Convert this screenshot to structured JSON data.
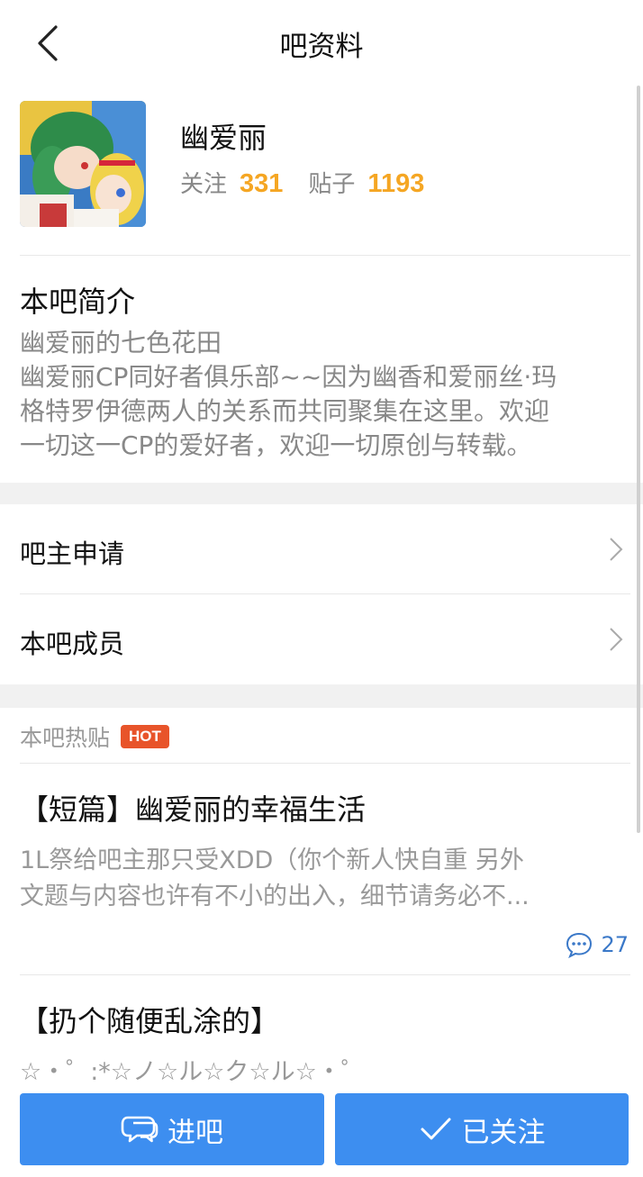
{
  "header": {
    "title": "吧资料",
    "back_icon": "chevron-left-icon"
  },
  "profile": {
    "name": "幽爱丽",
    "follow_label": "关注",
    "follow_count": "331",
    "posts_label": "贴子",
    "posts_count": "1193"
  },
  "intro": {
    "title": "本吧简介",
    "lines": [
      "幽爱丽的七色花田",
      "幽爱丽CP同好者俱乐部~~因为幽香和爱丽丝·玛",
      "格特罗伊德两人的关系而共同聚集在这里。欢迎",
      "一切这一CP的爱好者，欢迎一切原创与转载。"
    ]
  },
  "menu": {
    "items": [
      {
        "label": "吧主申请",
        "icon": "chevron-right-icon"
      },
      {
        "label": "本吧成员",
        "icon": "chevron-right-icon"
      }
    ]
  },
  "hot": {
    "label": "本吧热贴",
    "badge": "HOT",
    "posts": [
      {
        "title": "【短篇】幽爱丽的幸福生活",
        "snippet_lines": [
          "1L祭给吧主那只受XDD（你个新人快自重 另外",
          "文题与内容也许有不小的出入，细节请务必不..."
        ],
        "comments": "27"
      },
      {
        "title": "【扔个随便乱涂的】",
        "snippet_lines": [
          "☆・゜:*☆ノ☆ル☆ク☆ル☆・゜"
        ]
      }
    ]
  },
  "bottom": {
    "enter_label": "进吧",
    "enter_icon": "chat-bubble-icon",
    "follow_label": "已关注",
    "follow_icon": "checkmark-icon"
  },
  "colors": {
    "accent": "#3d8ef0",
    "count": "#f5a623",
    "hot_badge": "#e8542a",
    "link": "#3a78c8"
  }
}
